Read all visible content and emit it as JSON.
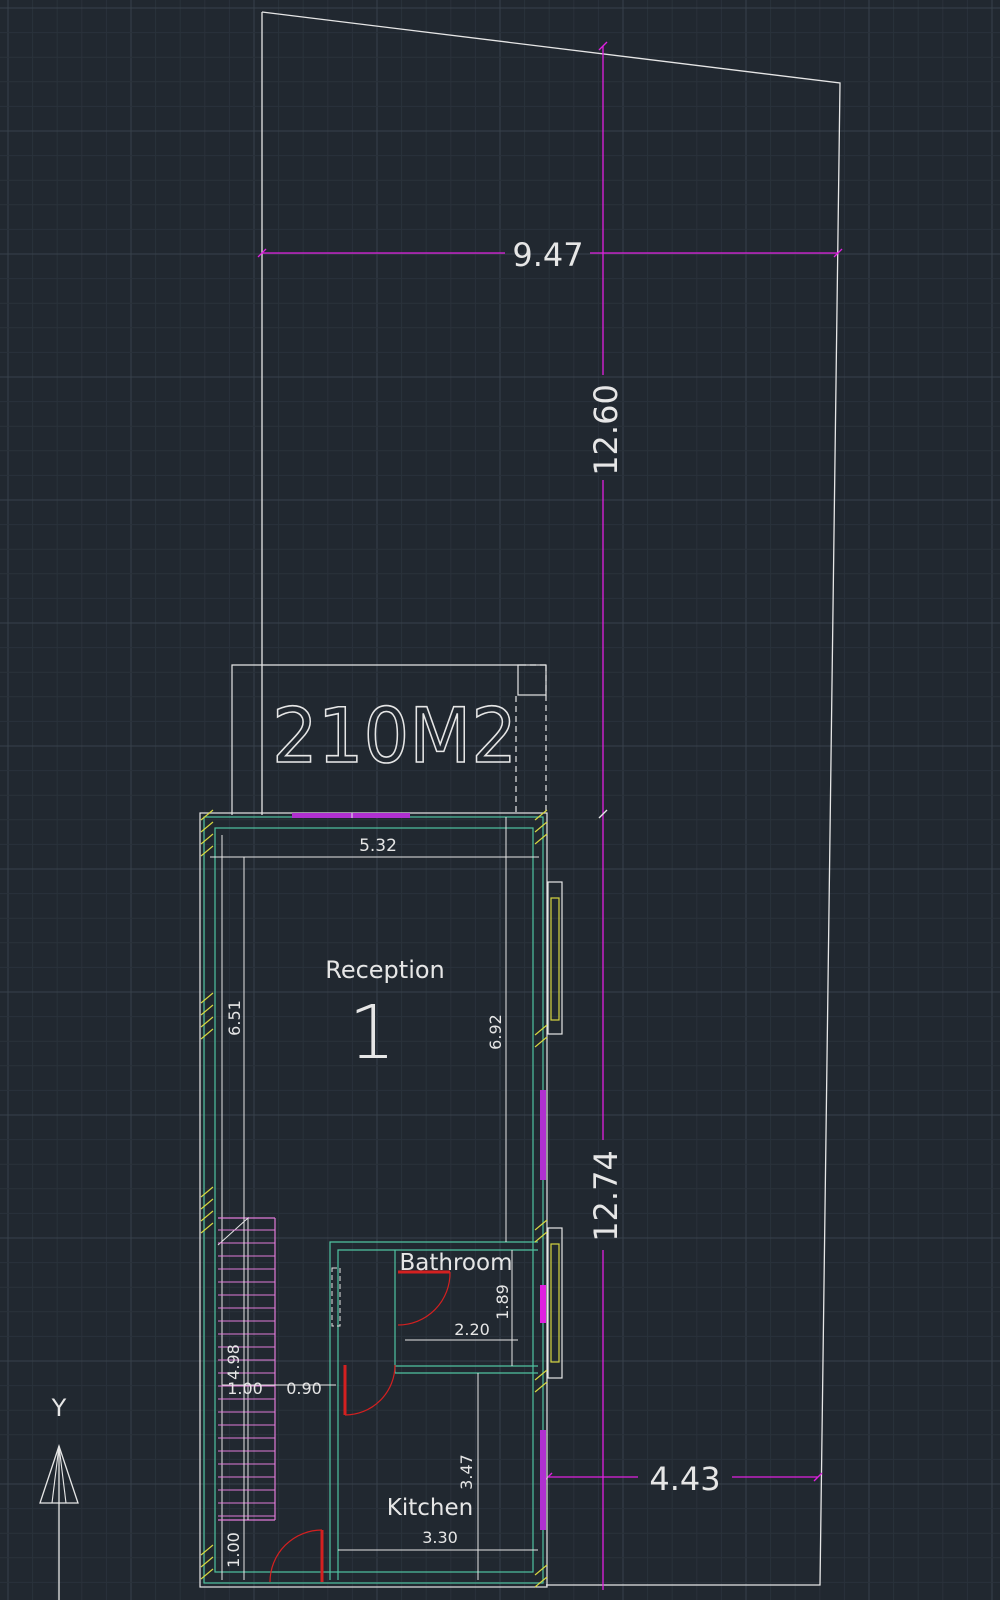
{
  "colors": {
    "background": "#212830",
    "grid_minor": "#2a323b",
    "grid_major": "#38414b",
    "outline": "#e6e6e6",
    "dimension": "#e020e0",
    "wall": "#4fc3a1",
    "hatch": "#d6d640",
    "door": "#d42020",
    "stairs": "#e07ad8",
    "window": "#b030d0"
  },
  "plot": {
    "area_label": "210M2",
    "dim_width_top": "9.47",
    "dim_depth_upper": "12.60",
    "dim_depth_lower": "12.74",
    "dim_width_bottom": "4.43"
  },
  "rooms": {
    "reception": {
      "name": "Reception",
      "number": "1",
      "width": "5.32",
      "left_height": "6.51",
      "right_height": "6.92"
    },
    "bathroom": {
      "name": "Bathroom",
      "width": "2.20",
      "height": "1.89"
    },
    "kitchen": {
      "name": "Kitchen",
      "width": "3.30",
      "height": "3.47"
    },
    "stairs": {
      "length": "4.98",
      "width": "1.00",
      "landing": "0.90",
      "bottom_gap": "1.00"
    }
  },
  "ucs": {
    "axis_label": "Y"
  }
}
